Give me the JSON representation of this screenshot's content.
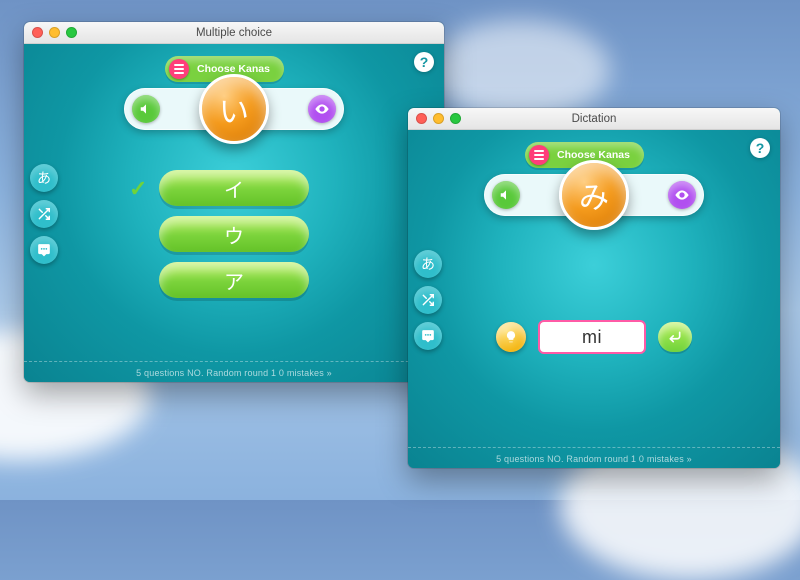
{
  "background": {
    "accent": "#7ad13f",
    "brand_circle": "#f49a1c"
  },
  "windows": {
    "mc": {
      "title": "Multiple choice",
      "choose_label": "Choose Kanas",
      "prompt_char": "い",
      "choices": [
        "イ",
        "ウ",
        "ア"
      ],
      "correct_index": 0,
      "status": "5 questions  NO. Random  round 1  0 mistakes  »"
    },
    "dict": {
      "title": "Dictation",
      "choose_label": "Choose Kanas",
      "prompt_char": "み",
      "answer_value": "mi",
      "status": "5 questions  NO. Random  round 1  0 mistakes  »"
    }
  },
  "icons": {
    "help": "?",
    "check": "✓",
    "rail_kana": "あ",
    "speaker_label": "sound",
    "eye_label": "reveal",
    "shuffle_label": "shuffle",
    "chat_label": "speak",
    "hint_label": "hint",
    "enter_label": "submit"
  }
}
